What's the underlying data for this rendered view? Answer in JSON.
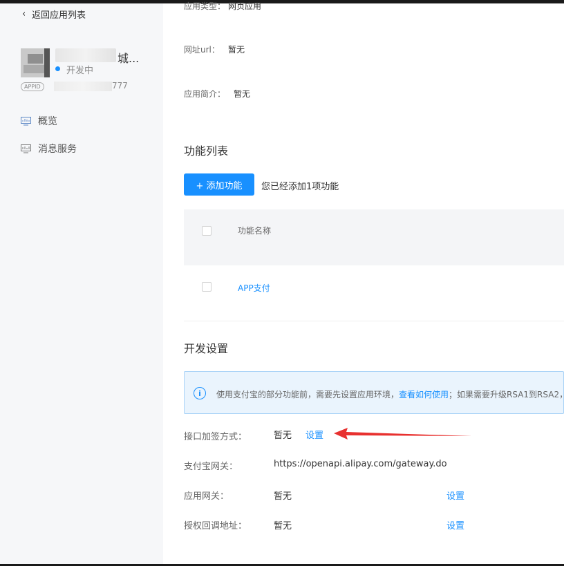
{
  "sidebar": {
    "back_label": "返回应用列表",
    "app_name_suffix": "城...",
    "status": "开发中",
    "appid_badge": "APPID",
    "appid_tail": "777",
    "nav": [
      {
        "label": "概览",
        "icon": "monitor-icon"
      },
      {
        "label": "消息服务",
        "icon": "chart-monitor-icon"
      }
    ]
  },
  "main": {
    "info_rows": [
      {
        "label": "应用类型：",
        "value": "网页应用"
      },
      {
        "label": "网址url：",
        "value": "暂无"
      },
      {
        "label": "应用简介：",
        "value": "暂无"
      }
    ],
    "function_list": {
      "title": "功能列表",
      "add_button": "+ 添加功能",
      "hint": "您已经添加1项功能",
      "column_header": "功能名称",
      "rows": [
        {
          "name": "APP支付"
        }
      ]
    },
    "dev_settings": {
      "title": "开发设置",
      "notice_prefix": "使用支付宝的部分功能前，需要先设置应用环境，",
      "notice_link": "查看如何使用",
      "notice_suffix": "；如果需要升级RSA1到RSA2，",
      "rows": [
        {
          "label": "接口加签方式：",
          "value": "暂无",
          "action": "设置"
        },
        {
          "label": "支付宝网关：",
          "value": "https://openapi.alipay.com/gateway.do",
          "action": ""
        },
        {
          "label": "应用网关：",
          "value": "暂无",
          "action": "设置"
        },
        {
          "label": "授权回调地址：",
          "value": "暂无",
          "action": "设置"
        }
      ]
    }
  },
  "colors": {
    "accent": "#1890ff",
    "arrow": "#e8312f",
    "sidebar_bg": "#f6f7f9",
    "notice_bg": "#eaf4fd"
  }
}
